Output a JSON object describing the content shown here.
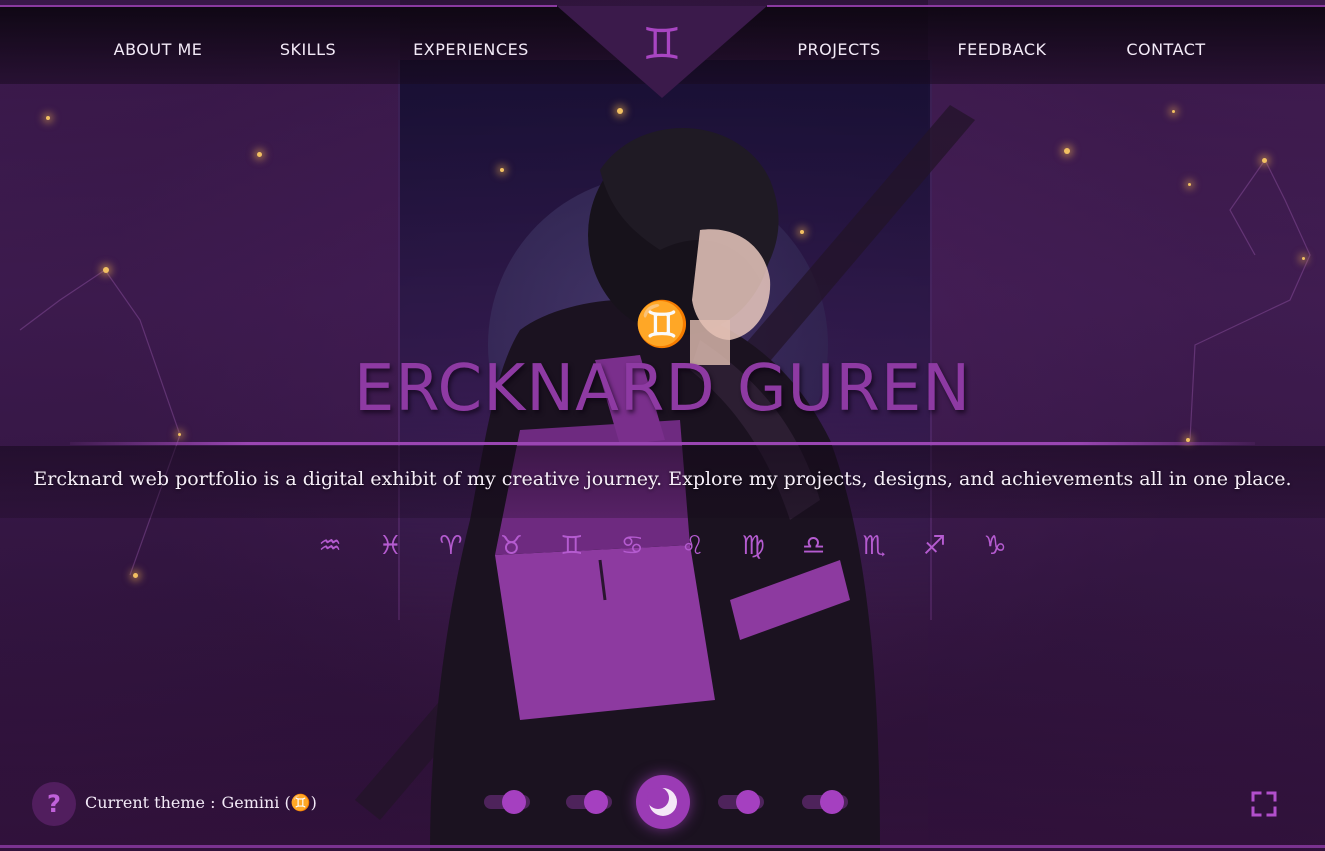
{
  "nav": {
    "items": [
      {
        "label": "ABOUT ME"
      },
      {
        "label": "SKILLS"
      },
      {
        "label": "EXPERIENCES"
      },
      {
        "label": "PROJECTS"
      },
      {
        "label": "FEEDBACK"
      },
      {
        "label": "CONTACT"
      }
    ],
    "emblem_symbol": "♊"
  },
  "hero": {
    "symbol": "♊",
    "title": "ERCKNARD GUREN",
    "description": "Ercknard web portfolio is a digital exhibit of my creative journey. Explore my projects, designs, and achievements all in one place."
  },
  "zodiac": [
    {
      "name": "aquarius",
      "glyph": "♒"
    },
    {
      "name": "pisces",
      "glyph": "♓"
    },
    {
      "name": "aries",
      "glyph": "♈"
    },
    {
      "name": "taurus",
      "glyph": "♉"
    },
    {
      "name": "gemini",
      "glyph": "♊"
    },
    {
      "name": "cancer",
      "glyph": "♋"
    },
    {
      "name": "leo",
      "glyph": "♌"
    },
    {
      "name": "virgo",
      "glyph": "♍"
    },
    {
      "name": "libra",
      "glyph": "♎"
    },
    {
      "name": "scorpio",
      "glyph": "♏"
    },
    {
      "name": "sagittarius",
      "glyph": "♐"
    },
    {
      "name": "capricorn",
      "glyph": "♑"
    }
  ],
  "footer": {
    "help_label": "?",
    "theme_label": "Current theme :",
    "theme_value": "Gemini (♊)"
  },
  "icons": {
    "help": "question-icon",
    "moon": "moon-icon",
    "fullscreen": "fullscreen-icon"
  },
  "colors": {
    "accent": "#9b3bb5",
    "title": "#8e3aa3",
    "zodiac": "#b55bd0",
    "background": "#2a1236",
    "star": "#f2c062"
  }
}
